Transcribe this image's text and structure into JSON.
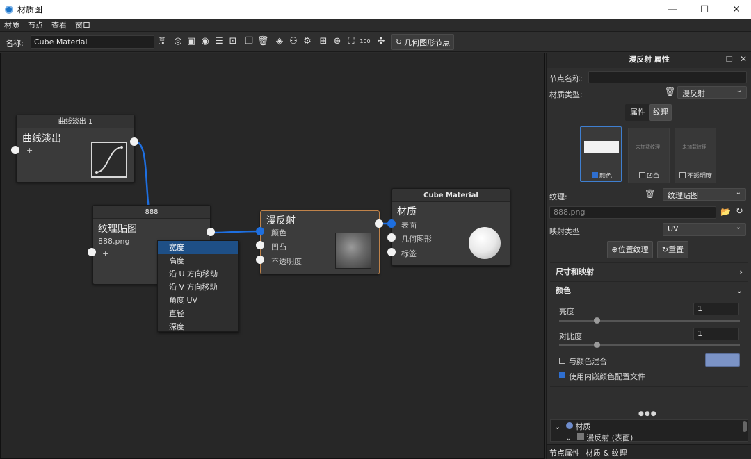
{
  "window": {
    "title": "材质图",
    "minimize": "—",
    "maximize": "☐",
    "close": "✕"
  },
  "menu": [
    "材质",
    "节点",
    "查看",
    "窗口"
  ],
  "toolbar": {
    "name_label": "名称:",
    "name_value": "Cube Material",
    "geo_node_label": "几何图形节点",
    "icons": [
      "save-icon",
      "bulb-icon",
      "checker-icon",
      "play-icon",
      "sliders-icon",
      "camera-icon",
      "copy-icon",
      "trash-icon",
      "node-add-icon",
      "graph-icon",
      "settings-icon",
      "layout-icon",
      "center-icon",
      "fit-icon",
      "zoom-100-icon",
      "pin-icon",
      "refresh-icon"
    ]
  },
  "nodes": {
    "curve": {
      "header": "曲线淡出 1",
      "title": "曲线淡出",
      "add": "+"
    },
    "texture": {
      "header": "888",
      "title": "纹理贴图",
      "file": "888.png",
      "add": "+"
    },
    "diffuse": {
      "title": "漫反射",
      "ports": [
        "颜色",
        "凹凸",
        "不透明度"
      ]
    },
    "material": {
      "header": "Cube Material",
      "title": "材质",
      "ports": [
        "表面",
        "几何图形",
        "标签"
      ]
    }
  },
  "context_menu": {
    "items": [
      "宽度",
      "高度",
      "沿 U 方向移动",
      "沿 V 方向移动",
      "角度 UV",
      "直径",
      "深度"
    ],
    "selected": 0
  },
  "panel": {
    "title": "漫反射 属性",
    "node_name_label": "节点名称:",
    "node_name_value": "",
    "material_type_label": "材质类型:",
    "material_type_value": "漫反射",
    "tab_attr": "属性",
    "tab_texture": "纹理",
    "tiles": [
      {
        "label": "颜色",
        "checked": true,
        "preview": ""
      },
      {
        "label": "凹凸",
        "checked": false,
        "preview": "未加载纹理"
      },
      {
        "label": "不透明度",
        "checked": false,
        "preview": "未加载纹理"
      }
    ],
    "texture_label": "纹理:",
    "texture_value": "纹理贴图",
    "texture_file": "888.png",
    "mapping_label": "映射类型",
    "mapping_value": "UV",
    "place_btn": "位置纹理",
    "reset_btn": "重置",
    "section_size": "尺寸和映射",
    "section_color": "颜色",
    "brightness_label": "亮度",
    "brightness_value": "1",
    "contrast_label": "对比度",
    "contrast_value": "1",
    "blend_label": "与颜色混合",
    "blend_checked": false,
    "blend_color": "#7b93c6",
    "embed_label": "使用内嵌颜色配置文件",
    "embed_checked": true,
    "more": "●●●",
    "tree": [
      "材质",
      "漫反射 (表面)"
    ],
    "bottom_tabs": [
      "节点属性",
      "材质 & 纹理"
    ]
  },
  "colors": {
    "accent_blue": "#1e6fe0",
    "diffuse_border": "#c0834a",
    "selection": "#1e4f86"
  }
}
